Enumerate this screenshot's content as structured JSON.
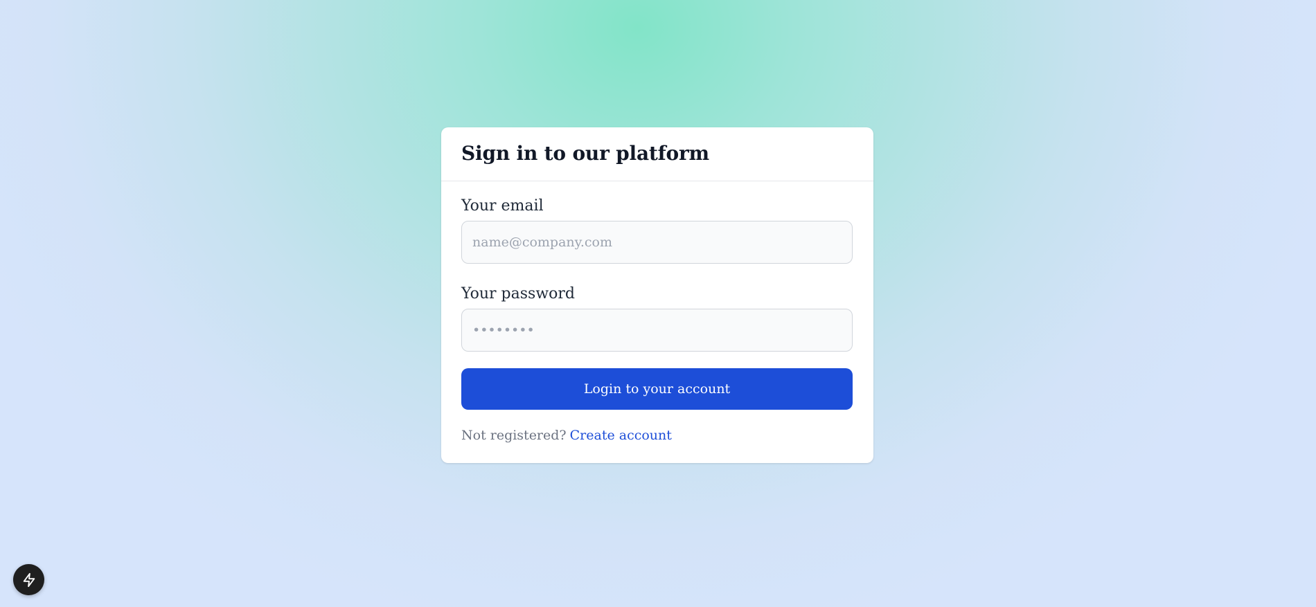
{
  "signin_card": {
    "title": "Sign in to our platform",
    "email": {
      "label": "Your email",
      "placeholder": "name@company.com",
      "value": ""
    },
    "password": {
      "label": "Your password",
      "placeholder": "••••••••",
      "value": ""
    },
    "submit_label": "Login to your account",
    "register_prompt": "Not registered?",
    "register_link": "Create account"
  },
  "floating_button": {
    "icon": "lightning-bolt-icon"
  },
  "colors": {
    "primary": "#1d4ed8",
    "card_bg": "#ffffff",
    "input_bg": "#f9fafb",
    "heading": "#111827",
    "muted": "#6b7280",
    "fab_bg": "#1f1f1f"
  }
}
